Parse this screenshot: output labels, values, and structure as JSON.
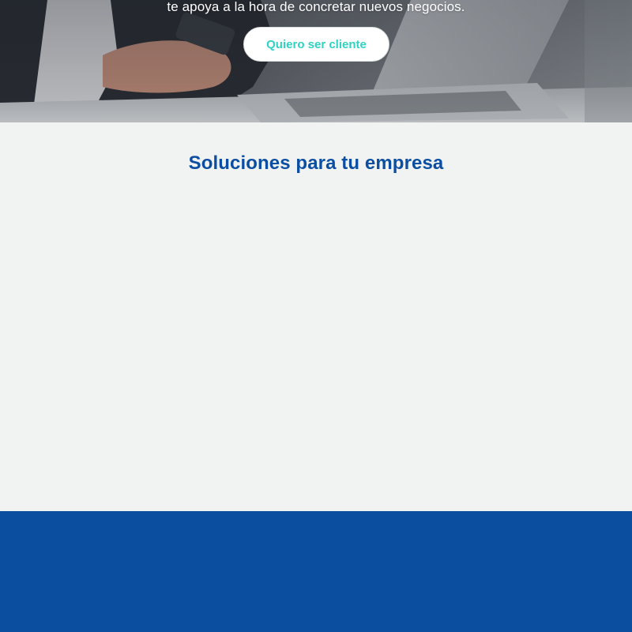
{
  "hero": {
    "subtitle": "te apoya a la hora de concretar nuevos negocios.",
    "cta_label": "Quiero ser cliente"
  },
  "solutions": {
    "title": "Soluciones para tu empresa"
  },
  "colors": {
    "brand_blue": "#0b4ea2",
    "band_blue": "#0b4d9f",
    "cta_text": "#2ed3c2",
    "section_bg": "#f1f2f2"
  }
}
